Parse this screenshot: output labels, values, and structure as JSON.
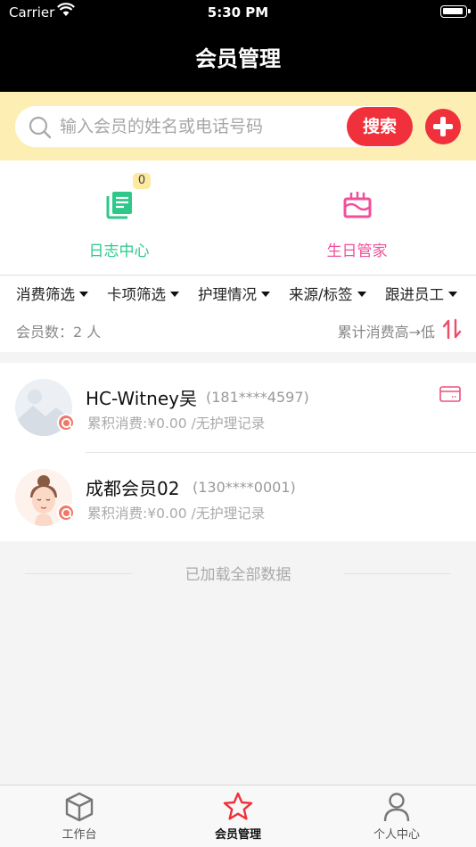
{
  "status_bar": {
    "carrier": "Carrier",
    "time": "5:30 PM"
  },
  "nav": {
    "title": "会员管理"
  },
  "search": {
    "placeholder": "输入会员的姓名或电话号码",
    "button_label": "搜索"
  },
  "shortcuts": [
    {
      "label": "日志中心",
      "icon": "log-document-icon",
      "color": "#2ec98a",
      "badge": "0"
    },
    {
      "label": "生日管家",
      "icon": "birthday-cake-icon",
      "color": "#f0509a"
    }
  ],
  "filters": [
    "消费筛选",
    "卡项筛选",
    "护理情况",
    "来源/标签",
    "跟进员工"
  ],
  "summary": {
    "count_label": "会员数：2 人",
    "sort_label": "累计消费高→低"
  },
  "members": [
    {
      "name": "HC-Witney吴",
      "phone": "(181****4597)",
      "detail": "累积消费:¥0.00 /无护理记录",
      "avatar": "placeholder-image-avatar",
      "has_card": true
    },
    {
      "name": "成都会员02",
      "phone": "(130****0001)",
      "detail": "累积消费:¥0.00 /无护理记录",
      "avatar": "cartoon-face-avatar",
      "has_card": false
    }
  ],
  "list_end": "已加载全部数据",
  "tabbar": [
    {
      "label": "工作台",
      "icon": "box-icon",
      "active": false
    },
    {
      "label": "会员管理",
      "icon": "star-icon",
      "active": true
    },
    {
      "label": "个人中心",
      "icon": "person-icon",
      "active": false
    }
  ],
  "colors": {
    "accent": "#f0303a",
    "search_band": "#fdefb3",
    "log_green": "#2ec98a",
    "birthday_pink": "#f0509a"
  }
}
